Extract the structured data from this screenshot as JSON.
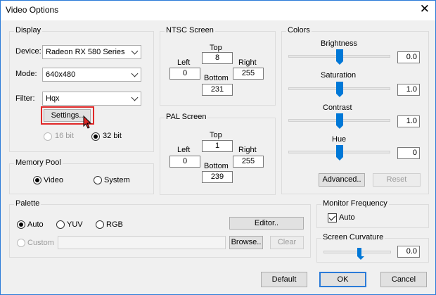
{
  "window": {
    "title": "Video Options"
  },
  "display": {
    "title": "Display",
    "device_label": "Device:",
    "device_value": "Radeon RX 580 Series",
    "mode_label": "Mode:",
    "mode_value": "640x480",
    "filter_label": "Filter:",
    "filter_value": "Hqx",
    "settings_button": "Settings..",
    "bit16_label": "16 bit",
    "bit32_label": "32 bit"
  },
  "ntsc": {
    "title": "NTSC Screen",
    "top_label": "Top",
    "top": "8",
    "left_label": "Left",
    "left": "0",
    "right_label": "Right",
    "right": "255",
    "bottom_label": "Bottom",
    "bottom": "231"
  },
  "pal": {
    "title": "PAL Screen",
    "top_label": "Top",
    "top": "1",
    "left_label": "Left",
    "left": "0",
    "right_label": "Right",
    "right": "255",
    "bottom_label": "Bottom",
    "bottom": "239"
  },
  "colors": {
    "title": "Colors",
    "brightness_label": "Brightness",
    "brightness": "0.0",
    "saturation_label": "Saturation",
    "saturation": "1.0",
    "contrast_label": "Contrast",
    "contrast": "1.0",
    "hue_label": "Hue",
    "hue": "0",
    "advanced_button": "Advanced..",
    "reset_button": "Reset"
  },
  "memory_pool": {
    "title": "Memory Pool",
    "video_label": "Video",
    "system_label": "System"
  },
  "palette": {
    "title": "Palette",
    "auto_label": "Auto",
    "yuv_label": "YUV",
    "rgb_label": "RGB",
    "custom_label": "Custom",
    "editor_button": "Editor..",
    "browse_button": "Browse..",
    "clear_button": "Clear"
  },
  "monitor_frequency": {
    "title": "Monitor Frequency",
    "auto_label": "Auto"
  },
  "screen_curvature": {
    "title": "Screen Curvature",
    "value": "0.0"
  },
  "footer": {
    "default_button": "Default",
    "ok_button": "OK",
    "cancel_button": "Cancel"
  },
  "colors_accent": {
    "slider": "#0078d7",
    "highlight": "#e02828",
    "focus": "#2b7bd8"
  }
}
